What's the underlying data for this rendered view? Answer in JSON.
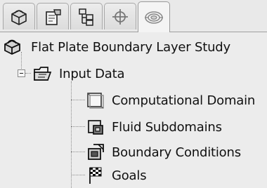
{
  "tabs": [
    {
      "icon": "feature-manager-icon",
      "active": false
    },
    {
      "icon": "property-manager-icon",
      "active": false
    },
    {
      "icon": "configuration-manager-icon",
      "active": false
    },
    {
      "icon": "dimxpert-manager-icon",
      "active": false
    },
    {
      "icon": "flow-simulation-analysis-tree-icon",
      "active": true
    }
  ],
  "tree": {
    "root": {
      "label": "Flat Plate Boundary Layer Study",
      "icon": "study-project-icon"
    },
    "input_data": {
      "label": "Input Data",
      "icon": "input-data-folder-icon",
      "expanded": true
    },
    "children": [
      {
        "label": "Computational Domain",
        "icon": "computational-domain-icon"
      },
      {
        "label": "Fluid Subdomains",
        "icon": "fluid-subdomains-icon"
      },
      {
        "label": "Boundary Conditions",
        "icon": "boundary-conditions-icon"
      },
      {
        "label": "Goals",
        "icon": "goals-flag-icon"
      }
    ]
  }
}
